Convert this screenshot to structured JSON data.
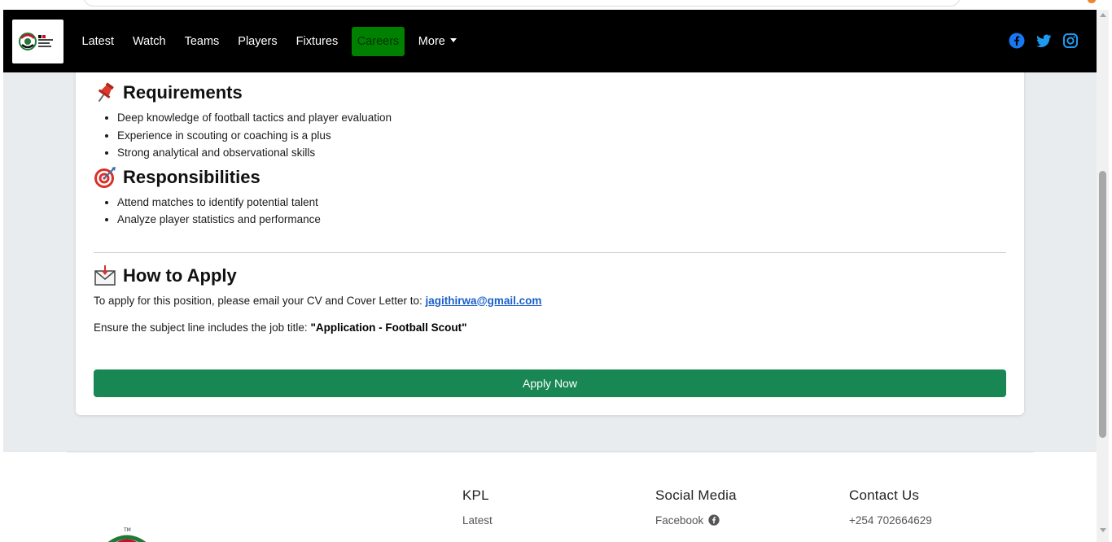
{
  "navbar": {
    "logo_text": "KPL",
    "items": [
      {
        "label": "Latest"
      },
      {
        "label": "Watch"
      },
      {
        "label": "Teams"
      },
      {
        "label": "Players"
      },
      {
        "label": "Fixtures"
      },
      {
        "label": "Careers",
        "active": true
      },
      {
        "label": "More"
      }
    ],
    "social_icons": [
      "facebook-icon",
      "twitter-icon",
      "instagram-icon"
    ],
    "accent_color": "#1877f2"
  },
  "requirements": {
    "title": "Requirements",
    "icon": "pushpin-icon",
    "items": [
      "Deep knowledge of football tactics and player evaluation",
      "Experience in scouting or coaching is a plus",
      "Strong analytical and observational skills"
    ]
  },
  "responsibilities": {
    "title": "Responsibilities",
    "icon": "target-icon",
    "items": [
      "Attend matches to identify potential talent",
      "Analyze player statistics and performance"
    ]
  },
  "how_to_apply": {
    "title": "How to Apply",
    "icon": "envelope-icon",
    "line1_prefix": "To apply for this position, please email your CV and Cover Letter to:",
    "email": "jagithirwa@gmail.com",
    "line2_prefix": "Ensure the subject line includes the job title:",
    "subject": "\"Application - Football Scout\""
  },
  "apply_button": {
    "label": "Apply Now",
    "color": "#198754"
  },
  "footer": {
    "kpl": {
      "heading": "KPL",
      "items": [
        "Latest"
      ]
    },
    "social": {
      "heading": "Social Media",
      "items": [
        "Facebook"
      ]
    },
    "contact": {
      "heading": "Contact Us",
      "items": [
        "+254 702664629"
      ]
    }
  }
}
